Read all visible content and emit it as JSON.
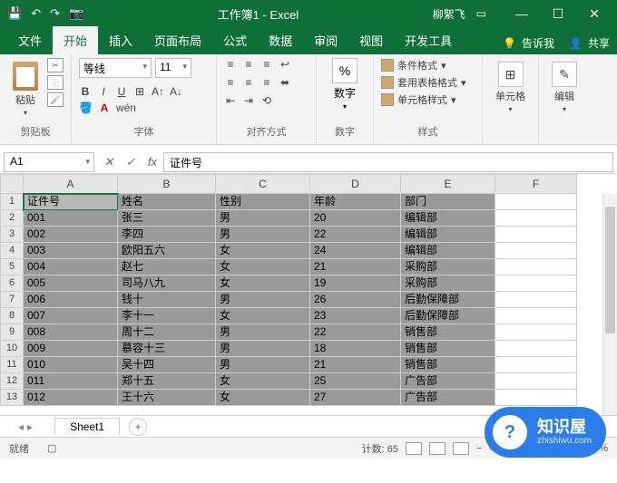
{
  "title": {
    "doc": "工作簿1",
    "app": "Excel",
    "user": "柳絮飞"
  },
  "qat": [
    "💾",
    "↶",
    "↷",
    "📷"
  ],
  "tabs": {
    "items": [
      "文件",
      "开始",
      "插入",
      "页面布局",
      "公式",
      "数据",
      "审阅",
      "视图",
      "开发工具"
    ],
    "tell": "告诉我",
    "share": "共享"
  },
  "ribbon": {
    "clipboard": {
      "paste": "粘贴",
      "label": "剪贴板"
    },
    "font": {
      "name": "等线",
      "size": "11",
      "label": "字体"
    },
    "align": {
      "label": "对齐方式"
    },
    "number": {
      "btn": "数字",
      "glyph": "%",
      "label": "数字"
    },
    "styles": {
      "cond": "条件格式",
      "table": "套用表格格式",
      "cell": "单元格样式",
      "label": "样式"
    },
    "cells": {
      "btn": "单元格"
    },
    "edit": {
      "btn": "编辑"
    }
  },
  "namebox": "A1",
  "formula": "证件号",
  "cols": [
    "A",
    "B",
    "C",
    "D",
    "E",
    "F"
  ],
  "rows": [
    "1",
    "2",
    "3",
    "4",
    "5",
    "6",
    "7",
    "8",
    "9",
    "10",
    "11",
    "12",
    "13"
  ],
  "data": [
    [
      "证件号",
      "姓名",
      "性别",
      "年龄",
      "部门",
      ""
    ],
    [
      "001",
      "张三",
      "男",
      "20",
      "编辑部",
      ""
    ],
    [
      "002",
      "李四",
      "男",
      "22",
      "编辑部",
      ""
    ],
    [
      "003",
      "欧阳五六",
      "女",
      "24",
      "编辑部",
      ""
    ],
    [
      "004",
      "赵七",
      "女",
      "21",
      "采购部",
      ""
    ],
    [
      "005",
      "司马八九",
      "女",
      "19",
      "采购部",
      ""
    ],
    [
      "006",
      "钱十",
      "男",
      "26",
      "后勤保障部",
      ""
    ],
    [
      "007",
      "李十一",
      "女",
      "23",
      "后勤保障部",
      ""
    ],
    [
      "008",
      "周十二",
      "男",
      "22",
      "销售部",
      ""
    ],
    [
      "009",
      "慕容十三",
      "男",
      "18",
      "销售部",
      ""
    ],
    [
      "010",
      "吴十四",
      "男",
      "21",
      "销售部",
      ""
    ],
    [
      "011",
      "郑十五",
      "女",
      "25",
      "广告部",
      ""
    ],
    [
      "012",
      "王十六",
      "女",
      "27",
      "广告部",
      ""
    ]
  ],
  "sheet": {
    "name": "Sheet1"
  },
  "status": {
    "ready": "就绪",
    "count_label": "计数:",
    "count": "65",
    "zoom": "100%"
  },
  "watermark": {
    "name": "知识屋",
    "url": "zhishiwu.com",
    "icon": "?"
  }
}
